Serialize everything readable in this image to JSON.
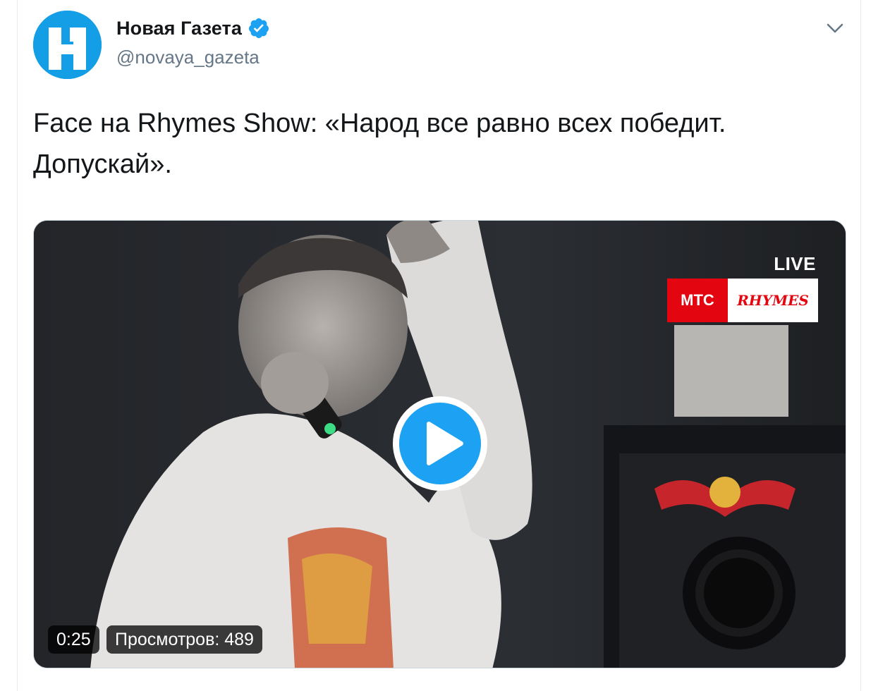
{
  "account": {
    "display_name": "Новая Газета",
    "handle": "@novaya_gazeta",
    "avatar_icon": "novaya-gazeta-logo",
    "verified_icon": "verified-badge-icon",
    "avatar_color": "#149ee6"
  },
  "menu": {
    "icon": "chevron-down-icon"
  },
  "tweet": {
    "text": "Face на Rhymes Show: «Народ все равно всех победит. Допускай»."
  },
  "video": {
    "overlay_live": "LIVE",
    "sponsor_left": "МТС",
    "sponsor_right": "RHYMES",
    "play_icon": "play-icon",
    "duration": "0:25",
    "views": "Просмотров: 489",
    "accent_color": "#1da1f2"
  }
}
